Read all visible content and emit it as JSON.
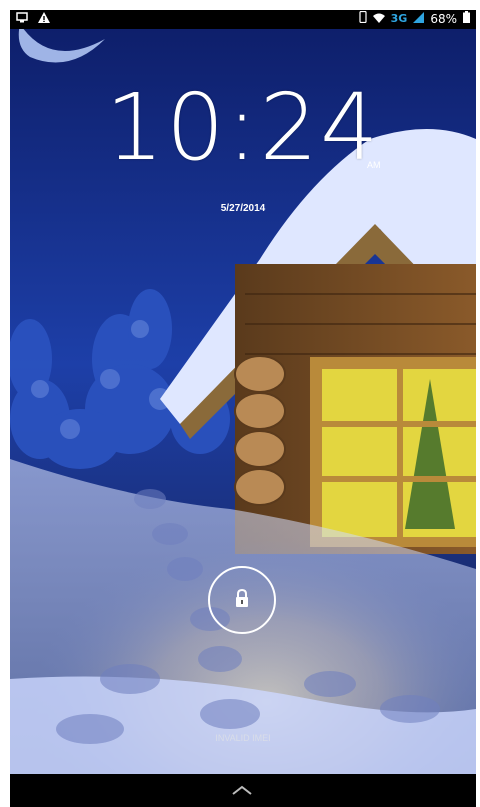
{
  "status_bar": {
    "network": "3G",
    "battery": "68%"
  },
  "lockscreen": {
    "time": "10:24",
    "ampm": "AM",
    "date": "5/27/2014",
    "imei_notice": "INVALID IMEI"
  },
  "icons": {
    "left": [
      "screenshot-icon",
      "warning-icon"
    ],
    "right": [
      "vibrate-icon",
      "wifi-icon",
      "signal-icon",
      "battery-icon"
    ],
    "unlock": "lock-icon",
    "nav": "chevron-up-icon"
  },
  "colors": {
    "status_bar_bg": "#000000",
    "network_accent": "#2fa5e0",
    "sky": "#1b3a9a",
    "window_glow": "#e3d640"
  }
}
